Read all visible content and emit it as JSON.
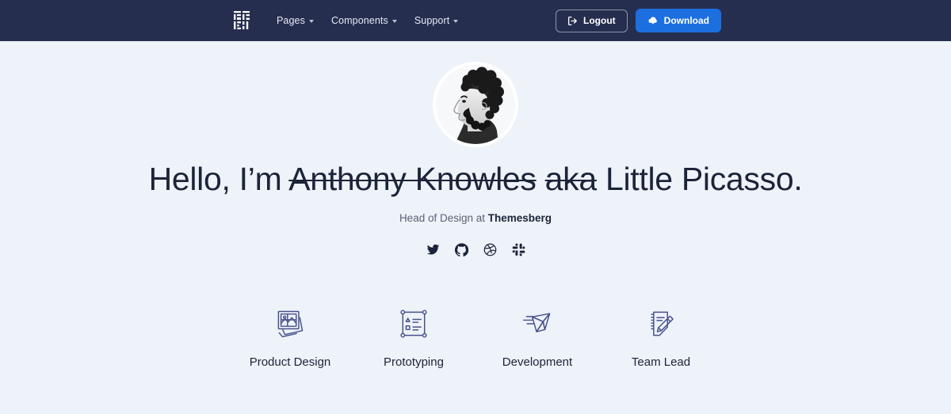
{
  "colors": {
    "navbar_bg": "#262e4f",
    "page_bg": "#eef2f9",
    "primary": "#1d6fe0",
    "text": "#1b2439",
    "muted": "#5a6274",
    "icon_accent": "#46518a"
  },
  "navbar": {
    "brand": {
      "icon": "themesberg-logo-icon",
      "label": ""
    },
    "links": [
      {
        "label": "Pages",
        "icon": "chevron-down-icon"
      },
      {
        "label": "Components",
        "icon": "chevron-down-icon"
      },
      {
        "label": "Support",
        "icon": "chevron-down-icon"
      }
    ],
    "actions": {
      "logout": {
        "label": "Logout",
        "icon": "sign-out-icon"
      },
      "download": {
        "label": "Download",
        "icon": "cloud-download-icon"
      }
    }
  },
  "hero": {
    "avatar": {
      "icon": "user-portrait-avatar",
      "alt": "Profile portrait"
    },
    "headline": {
      "greeting": "Hello, I’m ",
      "struck_name": "Anthony Knowles",
      "struck_aka": "aka",
      "nickname": " Little Picasso."
    },
    "subtitle": {
      "prefix": "Head of Design at ",
      "company": "Themesberg"
    },
    "socials": [
      {
        "name": "twitter",
        "icon": "twitter-icon"
      },
      {
        "name": "github",
        "icon": "github-icon"
      },
      {
        "name": "dribbble",
        "icon": "dribbble-icon"
      },
      {
        "name": "slack",
        "icon": "slack-icon"
      }
    ]
  },
  "features": [
    {
      "label": "Product Design",
      "icon": "photos-stack-icon"
    },
    {
      "label": "Prototyping",
      "icon": "artboard-wireframe-icon"
    },
    {
      "label": "Development",
      "icon": "paper-bird-icon"
    },
    {
      "label": "Team Lead",
      "icon": "notepad-pencil-icon"
    }
  ]
}
